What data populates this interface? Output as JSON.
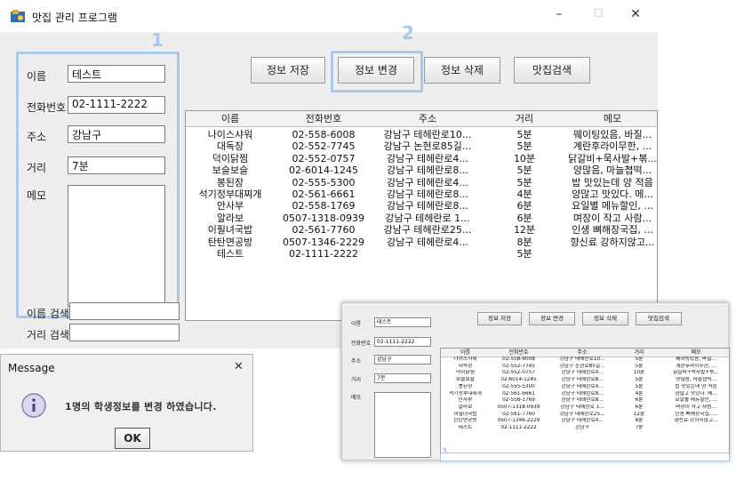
{
  "window": {
    "title": "맛집 관리 프로그램",
    "minimize": "–",
    "maximize": "☐",
    "close": "✕"
  },
  "annotations": {
    "n1": "1",
    "n2": "2",
    "n3": "3",
    "accent": "#a8c8f0"
  },
  "form": {
    "name_label": "이름",
    "name_value": "테스트",
    "phone_label": "전화번호",
    "phone_value": "02-1111-2222",
    "address_label": "주소",
    "address_value": "강남구",
    "distance_label": "거리",
    "distance_value": "7분",
    "memo_label": "메모",
    "memo_value": ""
  },
  "search": {
    "name_label": "이름 검색",
    "distance_label": "거리 검색"
  },
  "toolbar": {
    "save": "정보 저장",
    "edit": "정보 변경",
    "delete": "정보 삭제",
    "search": "맛집검색"
  },
  "table": {
    "headers": [
      "이름",
      "전화번호",
      "주소",
      "거리",
      "메모"
    ],
    "rows": [
      [
        "나이스샤워",
        "02-558-6008",
        "강남구 테헤란로10...",
        "5분",
        "웨이팅있음, 바질..."
      ],
      [
        "대독장",
        "02-552-7745",
        "강남구 논현로85길...",
        "5분",
        "계란후라이무한, ..."
      ],
      [
        "덕이닭찜",
        "02-552-0757",
        "강남구 테헤란로4...",
        "10분",
        "닭갈비+묵사발+볶..."
      ],
      [
        "보슬보슬",
        "02-6014-1245",
        "강남구 테헤란로8...",
        "5분",
        "양많음, 마늘쳡떡..."
      ],
      [
        "봉된장",
        "02-555-5300",
        "강남구 테헤란로4...",
        "5분",
        "밥 맛있는데 양 적음"
      ],
      [
        "석기정부대찌개",
        "02-561-6661",
        "강남구 테헤란로8...",
        "4분",
        "양많고 맛있다. 메..."
      ],
      [
        "안사부",
        "02-558-1769",
        "강남구 테헤란로8...",
        "6분",
        "요일별 메뉴할인, ..."
      ],
      [
        "알라보",
        "0507-1318-0939",
        "강남구 테헤란로 1...",
        "6분",
        "며장이 작고 사람..."
      ],
      [
        "이필녀국밥",
        "02-561-7760",
        "강남구 테헤란로25...",
        "12분",
        "인생 뼈해장국집, ..."
      ],
      [
        "탄탄면공방",
        "0507-1346-2229",
        "강남구 테헤란로4...",
        "8분",
        "향신료 강하지않고..."
      ],
      [
        "테스트",
        "02-1111-2222",
        "",
        "5분",
        ""
      ]
    ]
  },
  "dialog": {
    "title": "Message",
    "close": "✕",
    "message": "1명의 학생정보를 변경 하였습니다.",
    "ok": "OK"
  },
  "mini": {
    "table_rows": [
      [
        "나이스샤워",
        "02-558-6008",
        "강남구 테헤란로10...",
        "5분",
        "웨이팅있음, 바질..."
      ],
      [
        "대독장",
        "02-552-7745",
        "강남구 논현로85길...",
        "5분",
        "계란후라이무한, ..."
      ],
      [
        "덕이닭찜",
        "02-552-0757",
        "강남구 테헤란로4...",
        "10분",
        "닭갈비+묵사발+볶..."
      ],
      [
        "보슬보슬",
        "02-6014-1245",
        "강남구 테헤란로8...",
        "5분",
        "양많음, 마늘쳡떡..."
      ],
      [
        "봉된장",
        "02-555-5300",
        "강남구 테헤란로4...",
        "5분",
        "밥 맛있는데 양 적음"
      ],
      [
        "석기정부대찌개",
        "02-561-6661",
        "강남구 테헤란로8...",
        "4분",
        "양많고 맛있다. 메..."
      ],
      [
        "안사부",
        "02-558-1769",
        "강남구 테헤란로8...",
        "6분",
        "요일별 메뉴할인, ..."
      ],
      [
        "알라보",
        "0507-1318-0939",
        "강남구 테헤란로 1...",
        "6분",
        "며장이 작고 사람..."
      ],
      [
        "이필녀국밥",
        "02-561-7760",
        "강남구 테헤란로25...",
        "12분",
        "인생 뼈해장국집, ..."
      ],
      [
        "탄탄면공방",
        "0507-1346-2229",
        "강남구 테헤란로4...",
        "8분",
        "향신료 강하지않고..."
      ],
      [
        "테스트",
        "02-1111-2222",
        "강남구",
        "7분",
        ""
      ]
    ]
  }
}
